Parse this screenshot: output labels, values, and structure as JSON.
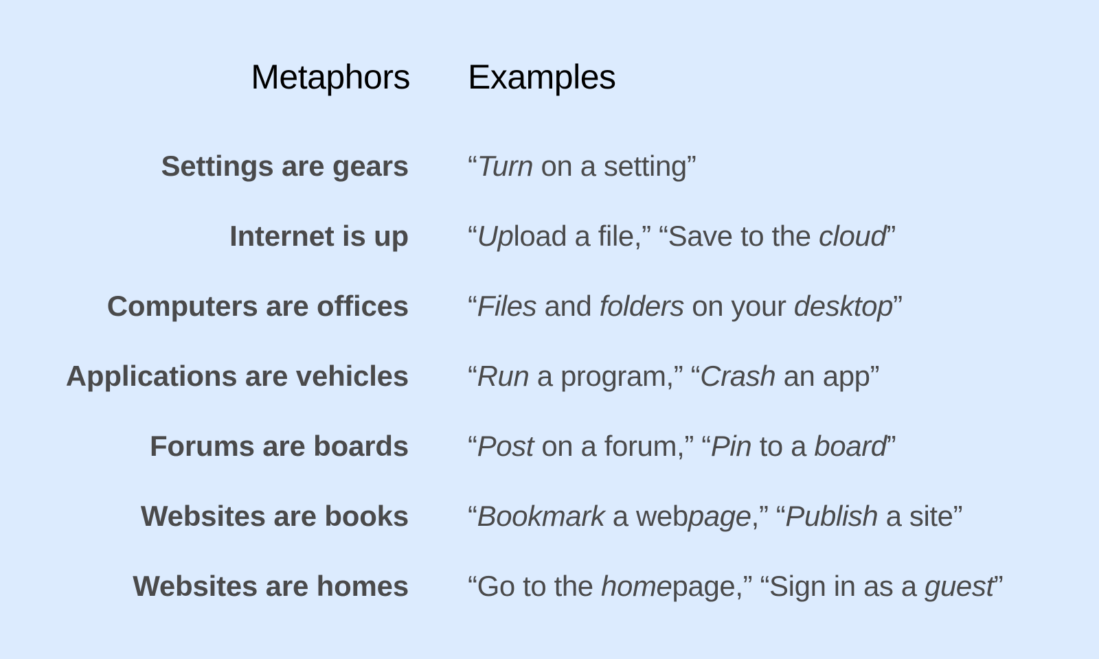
{
  "headers": {
    "metaphors": "Metaphors",
    "examples": "Examples"
  },
  "rows": [
    {
      "metaphor": "Settings are gears",
      "example": [
        {
          "t": "“"
        },
        {
          "t": "Turn",
          "i": true
        },
        {
          "t": " on a setting”"
        }
      ]
    },
    {
      "metaphor": "Internet is up",
      "example": [
        {
          "t": "“"
        },
        {
          "t": "Up",
          "i": true
        },
        {
          "t": "load a file,” “Save to the "
        },
        {
          "t": "cloud",
          "i": true
        },
        {
          "t": "”"
        }
      ]
    },
    {
      "metaphor": "Computers are offices",
      "example": [
        {
          "t": "“"
        },
        {
          "t": "Files",
          "i": true
        },
        {
          "t": " and "
        },
        {
          "t": "folders",
          "i": true
        },
        {
          "t": " on your "
        },
        {
          "t": "desktop",
          "i": true
        },
        {
          "t": "”"
        }
      ]
    },
    {
      "metaphor": "Applications are vehicles",
      "example": [
        {
          "t": "“"
        },
        {
          "t": "Run",
          "i": true
        },
        {
          "t": " a program,” “"
        },
        {
          "t": "Crash",
          "i": true
        },
        {
          "t": " an app”"
        }
      ]
    },
    {
      "metaphor": "Forums are boards",
      "example": [
        {
          "t": "“"
        },
        {
          "t": "Post",
          "i": true
        },
        {
          "t": " on a forum,” “"
        },
        {
          "t": "Pin",
          "i": true
        },
        {
          "t": " to a "
        },
        {
          "t": "board",
          "i": true
        },
        {
          "t": "”"
        }
      ]
    },
    {
      "metaphor": "Websites are books",
      "example": [
        {
          "t": "“"
        },
        {
          "t": "Bookmark",
          "i": true
        },
        {
          "t": " a web"
        },
        {
          "t": "page",
          "i": true
        },
        {
          "t": ",” “"
        },
        {
          "t": "Publish",
          "i": true
        },
        {
          "t": " a site”"
        }
      ]
    },
    {
      "metaphor": "Websites are homes",
      "example": [
        {
          "t": "“Go to the "
        },
        {
          "t": "home",
          "i": true
        },
        {
          "t": "page,” “Sign in as a "
        },
        {
          "t": "guest",
          "i": true
        },
        {
          "t": "”"
        }
      ]
    }
  ]
}
